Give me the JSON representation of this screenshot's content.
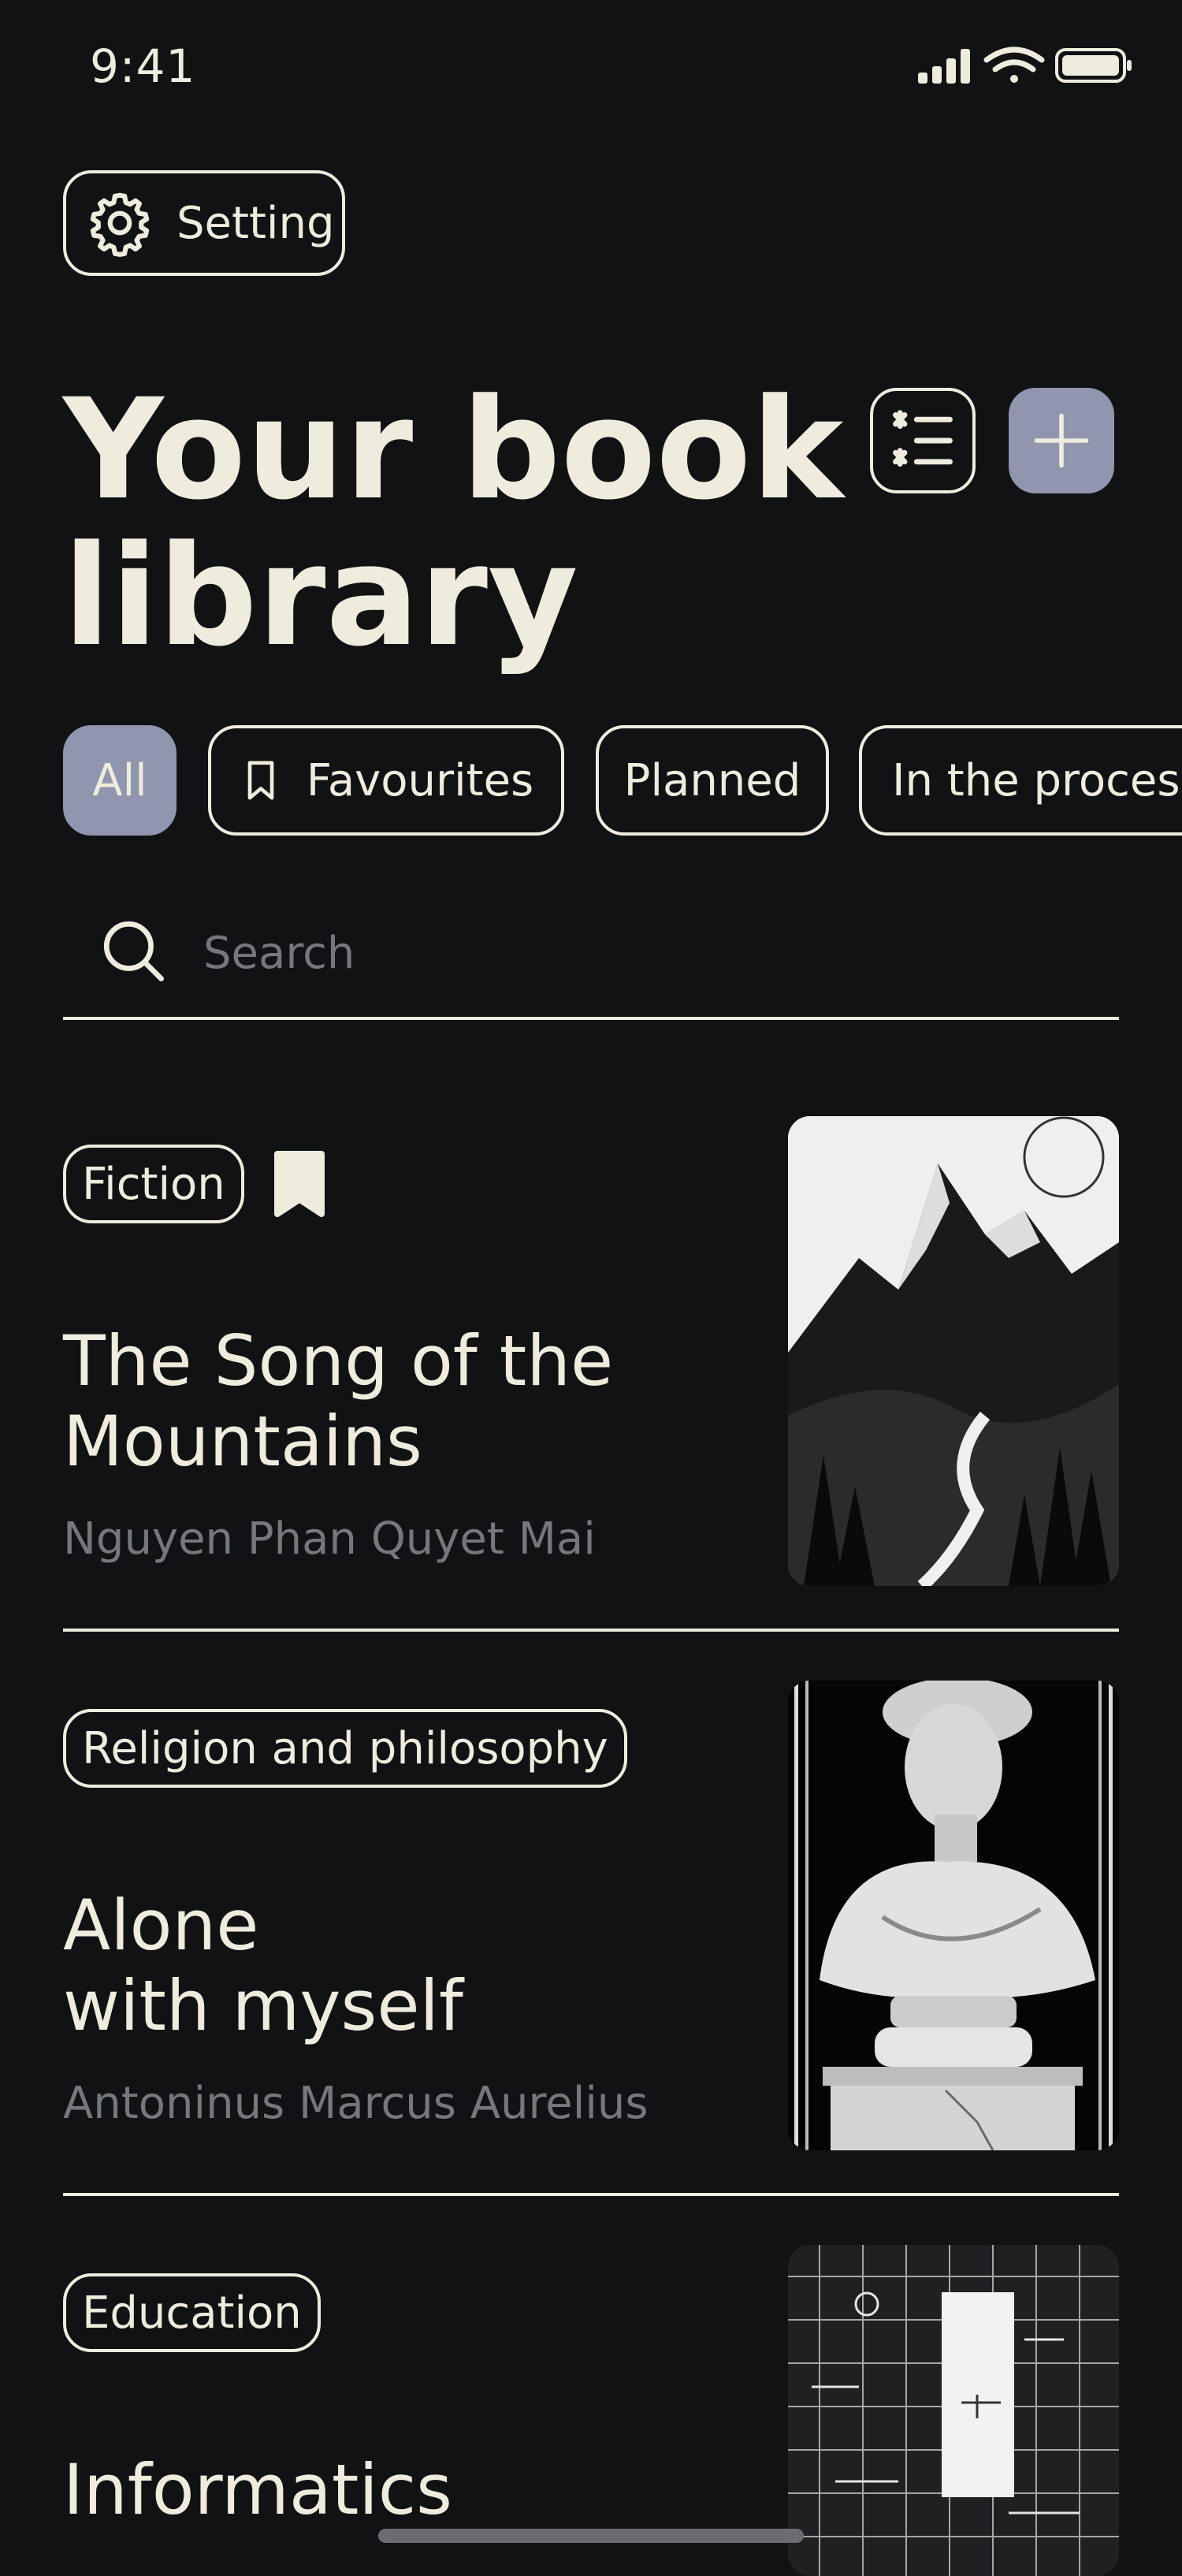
{
  "status": {
    "time": "9:41"
  },
  "header": {
    "setting_label": "Setting",
    "title_line1": "Your book",
    "title_line2": "library"
  },
  "filters": [
    {
      "label": "All",
      "active": true
    },
    {
      "label": "Favourites",
      "icon": "bookmark-icon"
    },
    {
      "label": "Planned"
    },
    {
      "label": "In the process"
    }
  ],
  "search": {
    "placeholder": "Search"
  },
  "books": [
    {
      "genre": "Fiction",
      "favourite": true,
      "title": "The Song of the\nMountains",
      "author": "Nguyen Phan Quyet Mai",
      "cover": "mountains-illustration"
    },
    {
      "genre": "Religion and philosophy",
      "favourite": false,
      "title": "Alone\nwith myself",
      "author": "Antoninus Marcus Aurelius",
      "cover": "marble-bust-illustration"
    },
    {
      "genre": "Education",
      "favourite": false,
      "title": "Informatics",
      "author": "",
      "cover": "blueprint-grid-illustration"
    }
  ],
  "colors": {
    "background": "#111214",
    "text": "#EFEBDD",
    "muted": "#74777D",
    "accent": "#8F96AE"
  }
}
